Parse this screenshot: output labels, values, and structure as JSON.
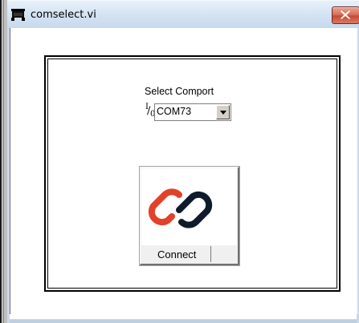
{
  "window": {
    "title": "comselect.vi",
    "icon": "labview-vi-icon",
    "close_icon": "close-icon"
  },
  "panel": {
    "comport": {
      "label": "Select Comport",
      "io_icon": "visa-io-icon",
      "value": "COM73",
      "dropdown_icon": "chevron-down-icon"
    },
    "connect": {
      "label": "Connect",
      "icon": "chain-link-icon",
      "colors": {
        "link_left": "#e2412a",
        "link_right": "#0f1a2a"
      }
    }
  },
  "colors": {
    "titlebar": "#d6e4f3",
    "close_button": "#c64b33",
    "panel_background": "#ffffff"
  }
}
